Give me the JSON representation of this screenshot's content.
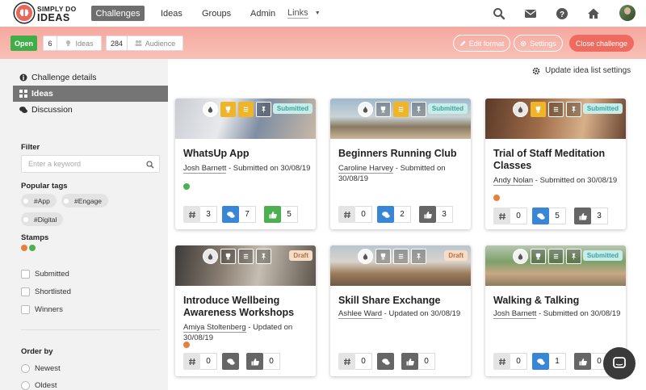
{
  "brand": {
    "line1": "SIMPLY DO",
    "line2": "IDEAS"
  },
  "nav": {
    "challenges": "Challenges",
    "ideas": "Ideas",
    "groups": "Groups",
    "admin": "Admin",
    "links": "Links"
  },
  "challenge_bar": {
    "status": "Open",
    "ideas_count": "6",
    "ideas_label": "Ideas",
    "audience_count": "284",
    "audience_label": "Audience",
    "edit_format": "Edit format",
    "settings": "Settings",
    "close": "Close challenge"
  },
  "sidebar": {
    "items": [
      {
        "label": "Challenge details"
      },
      {
        "label": "Ideas"
      },
      {
        "label": "Discussion"
      }
    ],
    "filter_label": "Filter",
    "search_placeholder": "Enter a keyword",
    "popular_tags_label": "Popular tags",
    "tags": [
      "#App",
      "#Engage",
      "#Digital"
    ],
    "stamps_label": "Stamps",
    "stamp_colors": [
      "#e8803a",
      "#4caf50"
    ],
    "checkboxes": [
      "Submitted",
      "Shortlisted",
      "Winners"
    ],
    "order_label": "Order by",
    "order_options": [
      "Newest",
      "Oldest"
    ]
  },
  "update_settings": "Update idea list settings",
  "cards": [
    {
      "title": "WhatsUp App",
      "author": "Josh Barnett",
      "meta": " - Submitted on 30/08/19",
      "badge": "Submitted",
      "dot": "#4caf50",
      "tags": "3",
      "comments": "7",
      "votes": "5"
    },
    {
      "title": "Beginners Running Club",
      "author": "Caroline Harvey",
      "meta": " - Submitted on 30/08/19",
      "badge": "Submitted",
      "dot": "",
      "tags": "0",
      "comments": "2",
      "votes": "3"
    },
    {
      "title": "Trial of Staff Meditation Classes",
      "author": "Andy Nolan",
      "meta": " - Submitted on 30/08/19",
      "badge": "Submitted",
      "dot": "#e8803a",
      "tags": "0",
      "comments": "5",
      "votes": "3"
    },
    {
      "title": "Introduce Wellbeing Awareness Workshops",
      "author": "Amiya Stoltenberg",
      "meta": " - Updated on 30/08/19",
      "badge": "Draft",
      "dot": "#e8803a",
      "tags": "0",
      "comments": "",
      "votes": "0"
    },
    {
      "title": "Skill Share Exchange",
      "author": "Ashlee Ward",
      "meta": " - Updated on 30/08/19",
      "badge": "Draft",
      "dot": "",
      "tags": "0",
      "comments": "",
      "votes": "0"
    },
    {
      "title": "Walking & Talking",
      "author": "Josh Barnett",
      "meta": " - Submitted on 30/08/19",
      "badge": "Submitted",
      "dot": "",
      "tags": "0",
      "comments": "1",
      "votes": "0"
    }
  ]
}
